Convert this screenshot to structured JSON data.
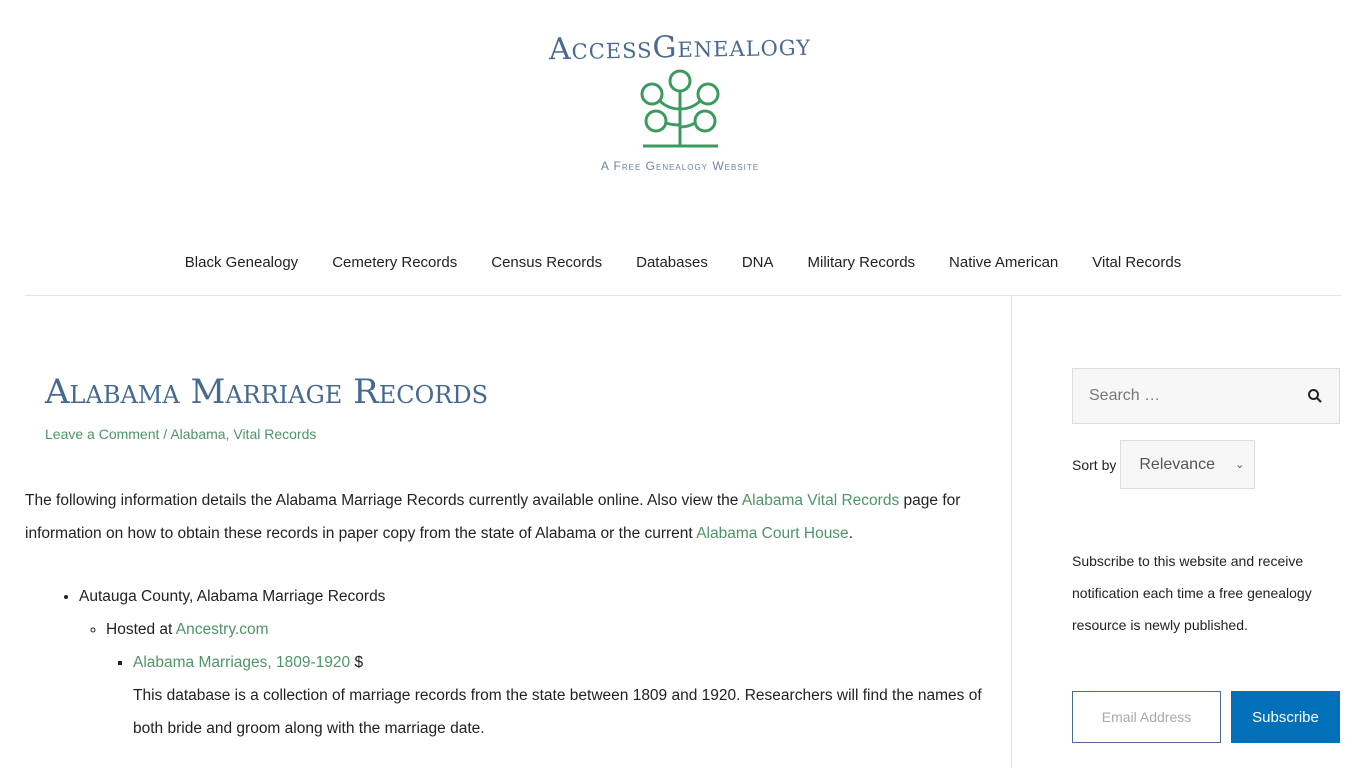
{
  "site": {
    "name": "AccessGenealogy",
    "tagline": "A Free Genealogy Website"
  },
  "nav": [
    "Black Genealogy",
    "Cemetery Records",
    "Census Records",
    "Databases",
    "DNA",
    "Military Records",
    "Native American",
    "Vital Records"
  ],
  "article": {
    "title": "Alabama Marriage Records",
    "meta": {
      "comment": "Leave a Comment",
      "sep": " / ",
      "cat1": "Alabama",
      "comma": ", ",
      "cat2": "Vital Records"
    },
    "intro": {
      "t1": "The following information details the Alabama Marriage Records currently available online. Also view the ",
      "l1": "Alabama Vital Records",
      "t2": " page for information on how to obtain these records in paper copy from the state of Alabama or the current ",
      "l2": "Alabama Court House",
      "t3": "."
    },
    "county": "Autauga County, Alabama Marriage Records",
    "hosted": "Hosted at ",
    "host_link": "Ancestry.com",
    "db_link": "Alabama Marriages, 1809-1920",
    "db_cost": " $",
    "db_desc": "This database is a collection of marriage records from the state between 1809 and 1920. Researchers will find the names of both bride and groom along with the marriage date."
  },
  "sidebar": {
    "search_placeholder": "Search …",
    "sort_label": "Sort by",
    "sort_value": "Relevance",
    "subscribe_text": "Subscribe to this website and receive notification each time a free genealogy resource is newly published.",
    "email_placeholder": "Email Address",
    "subscribe_button": "Subscribe"
  },
  "colors": {
    "title": "#46698f",
    "link": "#4f9467",
    "button": "#0170b9"
  }
}
